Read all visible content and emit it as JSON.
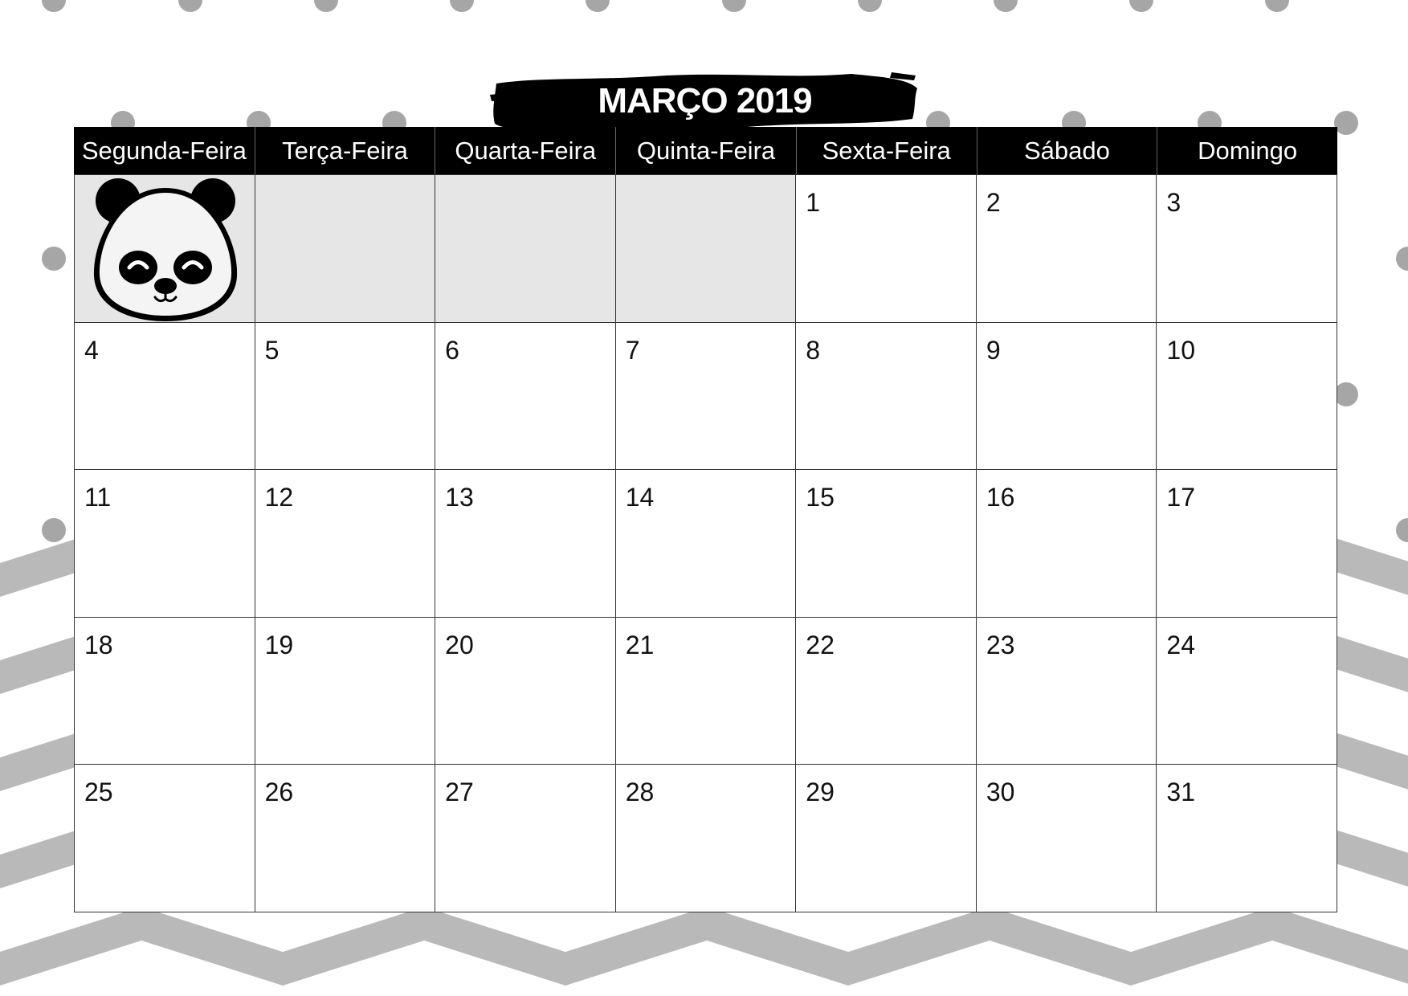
{
  "calendar": {
    "title": "MARÇO 2019",
    "weekdays": [
      "Segunda-Feira",
      "Terça-Feira",
      "Quarta-Feira",
      "Quinta-Feira",
      "Sexta-Feira",
      "Sábado",
      "Domingo"
    ],
    "weeks": [
      [
        "",
        "",
        "",
        "",
        "1",
        "2",
        "3"
      ],
      [
        "4",
        "5",
        "6",
        "7",
        "8",
        "9",
        "10"
      ],
      [
        "11",
        "12",
        "13",
        "14",
        "15",
        "16",
        "17"
      ],
      [
        "18",
        "19",
        "20",
        "21",
        "22",
        "23",
        "24"
      ],
      [
        "25",
        "26",
        "27",
        "28",
        "29",
        "30",
        "31"
      ]
    ],
    "decoration": "panda-face-icon"
  },
  "colors": {
    "header_background": "#000000",
    "empty_cell_background": "#e6e6e6",
    "pattern_gray": "#b3b3b3",
    "dot_gray": "#a6a6a6"
  }
}
